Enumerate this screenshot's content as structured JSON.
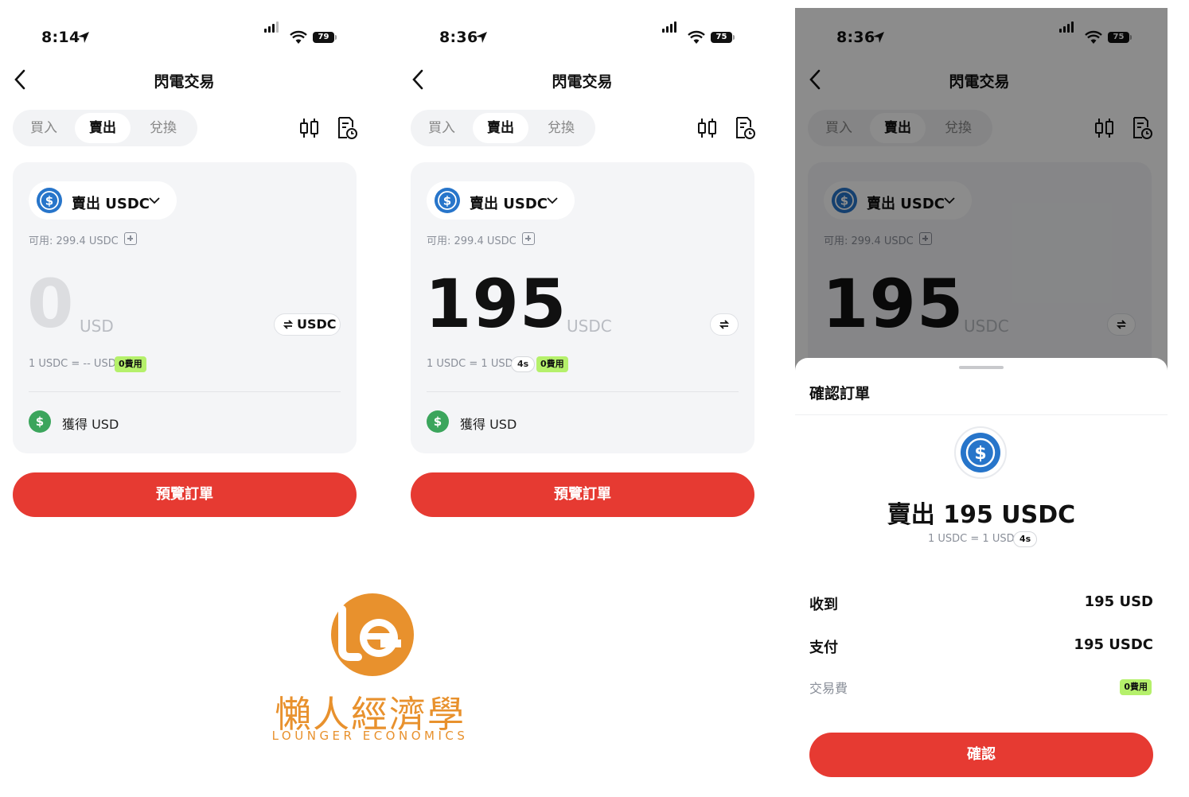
{
  "colors": {
    "accent_red": "#e63a32",
    "fee_green": "#b5f06b",
    "usdc_blue": "#2775ca",
    "dollar_green": "#3ba55c",
    "brand_orange": "#e8912d"
  },
  "screens": [
    {
      "status": {
        "time": "8:14",
        "battery": "79"
      },
      "nav": {
        "title": "閃電交易"
      },
      "tabs": [
        "買入",
        "賣出",
        "兌換"
      ],
      "asset_label": "賣出 USDC",
      "available": "可用: 299.4 USDC",
      "amount": "0",
      "unit": "USD",
      "swap_label": "USDC",
      "rate": "1 USDC = -- USD",
      "fee_badge": "0費用",
      "receive_label": "獲得 USD",
      "preview_button": "預覽訂單"
    },
    {
      "status": {
        "time": "8:36",
        "battery": "75"
      },
      "nav": {
        "title": "閃電交易"
      },
      "tabs": [
        "買入",
        "賣出",
        "兌換"
      ],
      "asset_label": "賣出 USDC",
      "available": "可用: 299.4 USDC",
      "amount": "195",
      "unit": "USDC",
      "rate": "1 USDC = 1 USD",
      "countdown": "4s",
      "fee_badge": "0費用",
      "receive_label": "獲得 USD",
      "preview_button": "預覽訂單"
    },
    {
      "status": {
        "time": "8:36",
        "battery": "75"
      },
      "nav": {
        "title": "閃電交易"
      },
      "tabs": [
        "買入",
        "賣出",
        "兌換"
      ],
      "asset_label": "賣出 USDC",
      "available": "可用: 299.4 USDC",
      "amount": "195",
      "unit": "USDC",
      "sheet": {
        "title": "確認訂單",
        "sell_line": "賣出 195 USDC",
        "rate": "1 USDC = 1 USD",
        "countdown": "4s",
        "receive_label": "收到",
        "receive_value": "195 USD",
        "pay_label": "支付",
        "pay_value": "195 USDC",
        "fee_label": "交易費",
        "fee_badge": "0費用",
        "confirm_button": "確認"
      }
    }
  ],
  "logo": {
    "cn": "懶人經濟學",
    "en": "LOUNGER ECONOMICS"
  }
}
